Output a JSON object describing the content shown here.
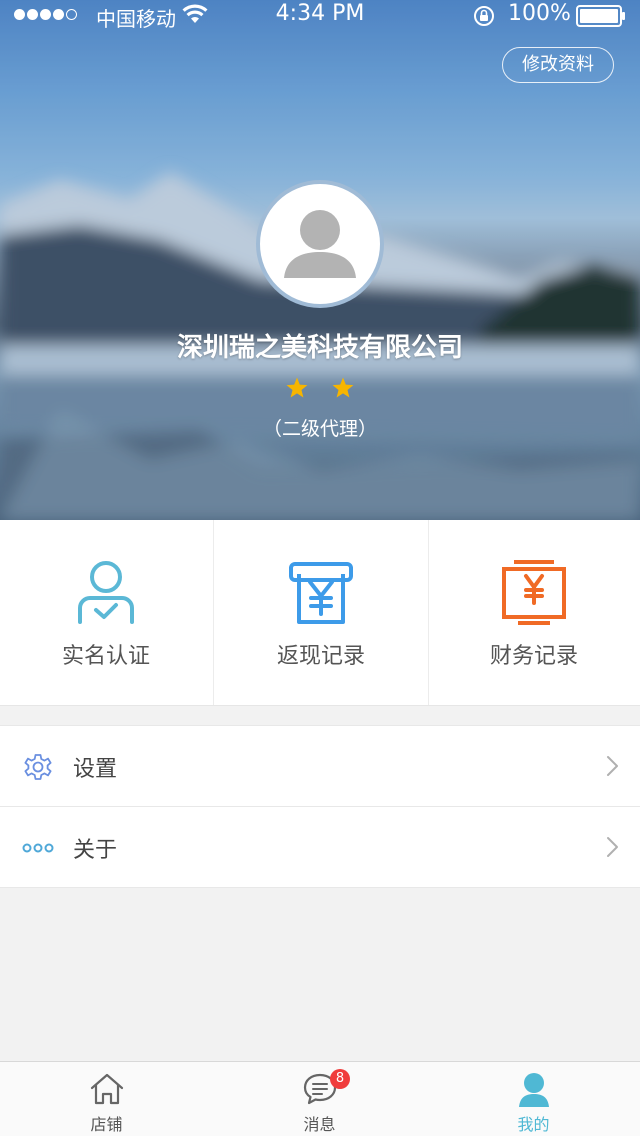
{
  "status_bar": {
    "carrier": "中国移动",
    "time": "4:34 PM",
    "battery": "100%"
  },
  "header": {
    "edit_profile_label": "修改资料",
    "company_name": "深圳瑞之美科技有限公司",
    "rating_stars": 2,
    "agent_level": "（二级代理）"
  },
  "actions": [
    {
      "label": "实名认证",
      "icon": "user-verified-icon",
      "color": "#5bb8d6"
    },
    {
      "label": "返现记录",
      "icon": "yen-receipt-icon",
      "color": "#3d9be9"
    },
    {
      "label": "财务记录",
      "icon": "yen-register-icon",
      "color": "#f06a25"
    }
  ],
  "menu": [
    {
      "label": "设置",
      "icon": "gear-icon"
    },
    {
      "label": "关于",
      "icon": "more-dots-icon"
    }
  ],
  "tabbar": {
    "tabs": [
      {
        "label": "店铺",
        "icon": "home-icon"
      },
      {
        "label": "消息",
        "icon": "chat-icon",
        "badge": "8"
      },
      {
        "label": "我的",
        "icon": "person-icon",
        "active": true
      }
    ]
  },
  "colors": {
    "accent": "#4fb8d4",
    "star": "#f7b500",
    "badge": "#f03c3c",
    "background": "#f2f2f2"
  }
}
